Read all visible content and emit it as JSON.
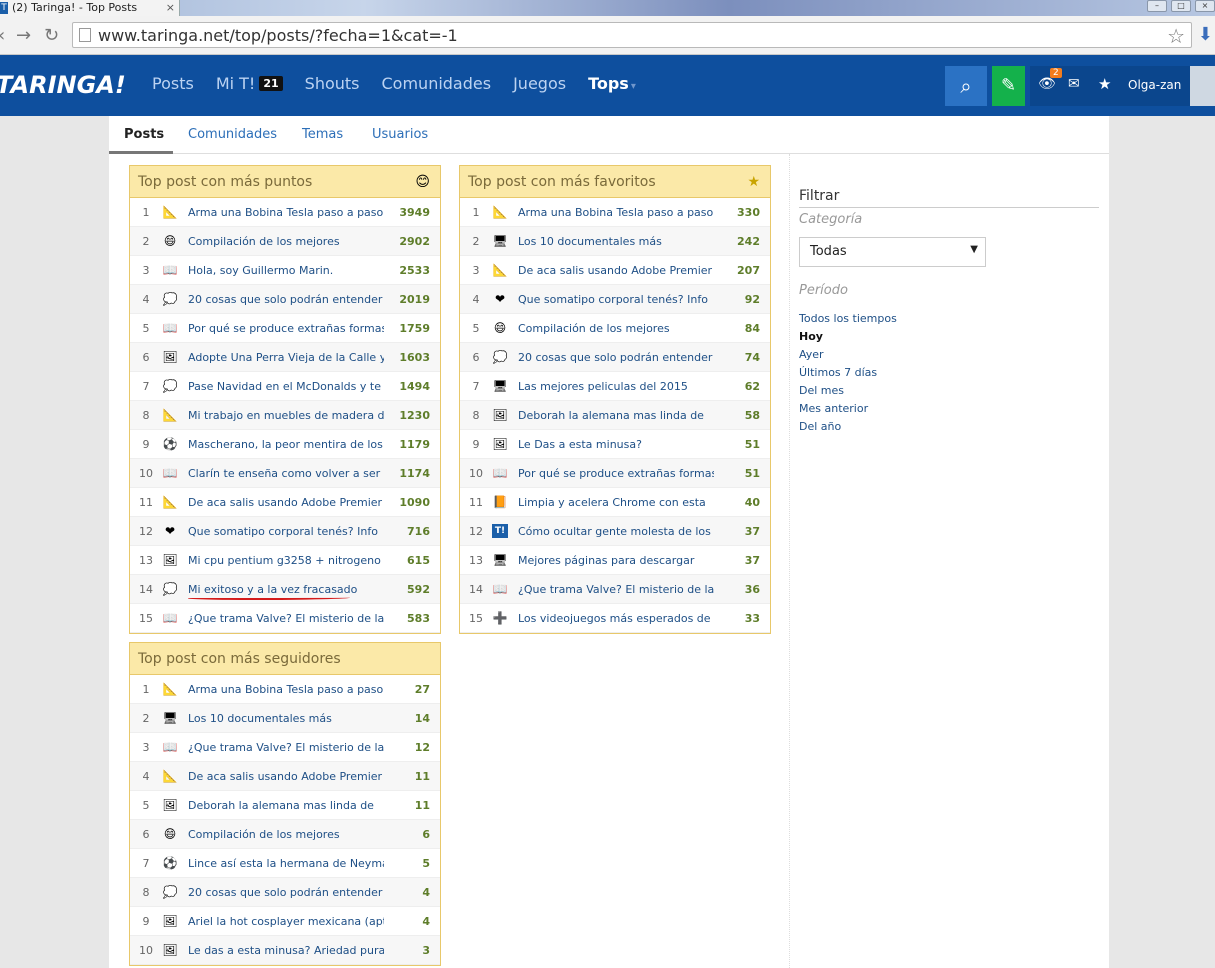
{
  "browser": {
    "tab_title": "(2) Taringa! - Top Posts",
    "tab_favicon": "T",
    "url": "www.taringa.net/top/posts/?fecha=1&cat=-1"
  },
  "header": {
    "logo": "TARINGA!",
    "nav": [
      {
        "label": "Posts"
      },
      {
        "label": "Mi T!",
        "badge": "21"
      },
      {
        "label": "Shouts"
      },
      {
        "label": "Comunidades"
      },
      {
        "label": "Juegos"
      },
      {
        "label": "Tops"
      }
    ],
    "notifications": "2",
    "username": "Olga-zan"
  },
  "subtabs": [
    "Posts",
    "Comunidades",
    "Temas",
    "Usuarios"
  ],
  "panels": [
    {
      "title": "Top post con más puntos",
      "icon": "smiley-icon",
      "rows": [
        {
          "n": "1",
          "icon": "📐",
          "title": "Arma una Bobina Tesla paso a paso-",
          "score": "3949"
        },
        {
          "n": "2",
          "icon": "😄",
          "title": "Compilación de los mejores",
          "score": "2902"
        },
        {
          "n": "3",
          "icon": "📖",
          "title": "Hola, soy Guillermo Marin.",
          "score": "2533"
        },
        {
          "n": "4",
          "icon": "💭",
          "title": "20 cosas que solo podrán entender",
          "score": "2019"
        },
        {
          "n": "5",
          "icon": "📖",
          "title": "Por qué se produce extrañas formas",
          "score": "1759"
        },
        {
          "n": "6",
          "icon": "🖼",
          "title": "Adopte Una Perra Vieja de la Calle y",
          "score": "1603"
        },
        {
          "n": "7",
          "icon": "💭",
          "title": "Pase Navidad en el McDonalds y te lo",
          "score": "1494"
        },
        {
          "n": "8",
          "icon": "📐",
          "title": "Mi trabajo en muebles de madera de",
          "score": "1230"
        },
        {
          "n": "9",
          "icon": "⚽",
          "title": "Mascherano, la peor mentira de los",
          "score": "1179"
        },
        {
          "n": "10",
          "icon": "📖",
          "title": "Clarín te enseña como volver a ser",
          "score": "1174"
        },
        {
          "n": "11",
          "icon": "📐",
          "title": "De aca salis usando Adobe Premier",
          "score": "1090"
        },
        {
          "n": "12",
          "icon": "❤",
          "title": "Que somatipo corporal tenés? Info",
          "score": "716"
        },
        {
          "n": "13",
          "icon": "🖼",
          "title": "Mi cpu pentium g3258 + nitrogeno",
          "score": "615"
        },
        {
          "n": "14",
          "icon": "💭",
          "title": "Mi exitoso y a la vez fracasado",
          "score": "592"
        },
        {
          "n": "15",
          "icon": "📖",
          "title": "¿Que trama Valve? El misterio de las",
          "score": "583"
        }
      ]
    },
    {
      "title": "Top post con más favoritos",
      "icon": "star-plus-icon",
      "rows": [
        {
          "n": "1",
          "icon": "📐",
          "title": "Arma una Bobina Tesla paso a paso-",
          "score": "330"
        },
        {
          "n": "2",
          "icon": "🖥",
          "title": "Los 10 documentales más",
          "score": "242"
        },
        {
          "n": "3",
          "icon": "📐",
          "title": "De aca salis usando Adobe Premier",
          "score": "207"
        },
        {
          "n": "4",
          "icon": "❤",
          "title": "Que somatipo corporal tenés? Info",
          "score": "92"
        },
        {
          "n": "5",
          "icon": "😄",
          "title": "Compilación de los mejores",
          "score": "84"
        },
        {
          "n": "6",
          "icon": "💭",
          "title": "20 cosas que solo podrán entender",
          "score": "74"
        },
        {
          "n": "7",
          "icon": "🖥",
          "title": "Las mejores peliculas del 2015",
          "score": "62"
        },
        {
          "n": "8",
          "icon": "🖼",
          "title": "Deborah la alemana mas linda de",
          "score": "58"
        },
        {
          "n": "9",
          "icon": "🖼",
          "title": "Le Das a esta minusa?",
          "score": "51"
        },
        {
          "n": "10",
          "icon": "📖",
          "title": "Por qué se produce extrañas formas",
          "score": "51"
        },
        {
          "n": "11",
          "icon": "📙",
          "title": "Limpia y acelera Chrome con esta",
          "score": "40"
        },
        {
          "n": "12",
          "icon": "T!",
          "title": "Cómo ocultar gente molesta de los",
          "score": "37"
        },
        {
          "n": "13",
          "icon": "🖥",
          "title": "Mejores páginas para descargar",
          "score": "37"
        },
        {
          "n": "14",
          "icon": "📖",
          "title": "¿Que trama Valve? El misterio de las",
          "score": "36"
        },
        {
          "n": "15",
          "icon": "➕",
          "title": "Los videojuegos más esperados de",
          "score": "33"
        }
      ]
    },
    {
      "title": "Top post con más seguidores",
      "icon": "",
      "rows": [
        {
          "n": "1",
          "icon": "📐",
          "title": "Arma una Bobina Tesla paso a paso-",
          "score": "27"
        },
        {
          "n": "2",
          "icon": "🖥",
          "title": "Los 10 documentales más",
          "score": "14"
        },
        {
          "n": "3",
          "icon": "📖",
          "title": "¿Que trama Valve? El misterio de las",
          "score": "12"
        },
        {
          "n": "4",
          "icon": "📐",
          "title": "De aca salis usando Adobe Premier",
          "score": "11"
        },
        {
          "n": "5",
          "icon": "🖼",
          "title": "Deborah la alemana mas linda de",
          "score": "11"
        },
        {
          "n": "6",
          "icon": "😄",
          "title": "Compilación de los mejores",
          "score": "6"
        },
        {
          "n": "7",
          "icon": "⚽",
          "title": "Lince así esta la hermana de Neymar",
          "score": "5"
        },
        {
          "n": "8",
          "icon": "💭",
          "title": "20 cosas que solo podrán entender",
          "score": "4"
        },
        {
          "n": "9",
          "icon": "🖼",
          "title": "Ariel la hot cosplayer mexicana (apto",
          "score": "4"
        },
        {
          "n": "10",
          "icon": "🖼",
          "title": "Le das a esta minusa? Ariedad pura y",
          "score": "3"
        }
      ]
    }
  ],
  "filter": {
    "title": "Filtrar",
    "category_label": "Categoría",
    "category_value": "Todas",
    "period_label": "Período",
    "periods": [
      "Todos los tiempos",
      "Hoy",
      "Ayer",
      "Últimos 7 días",
      "Del mes",
      "Mes anterior",
      "Del año"
    ],
    "active_period": "Hoy"
  }
}
